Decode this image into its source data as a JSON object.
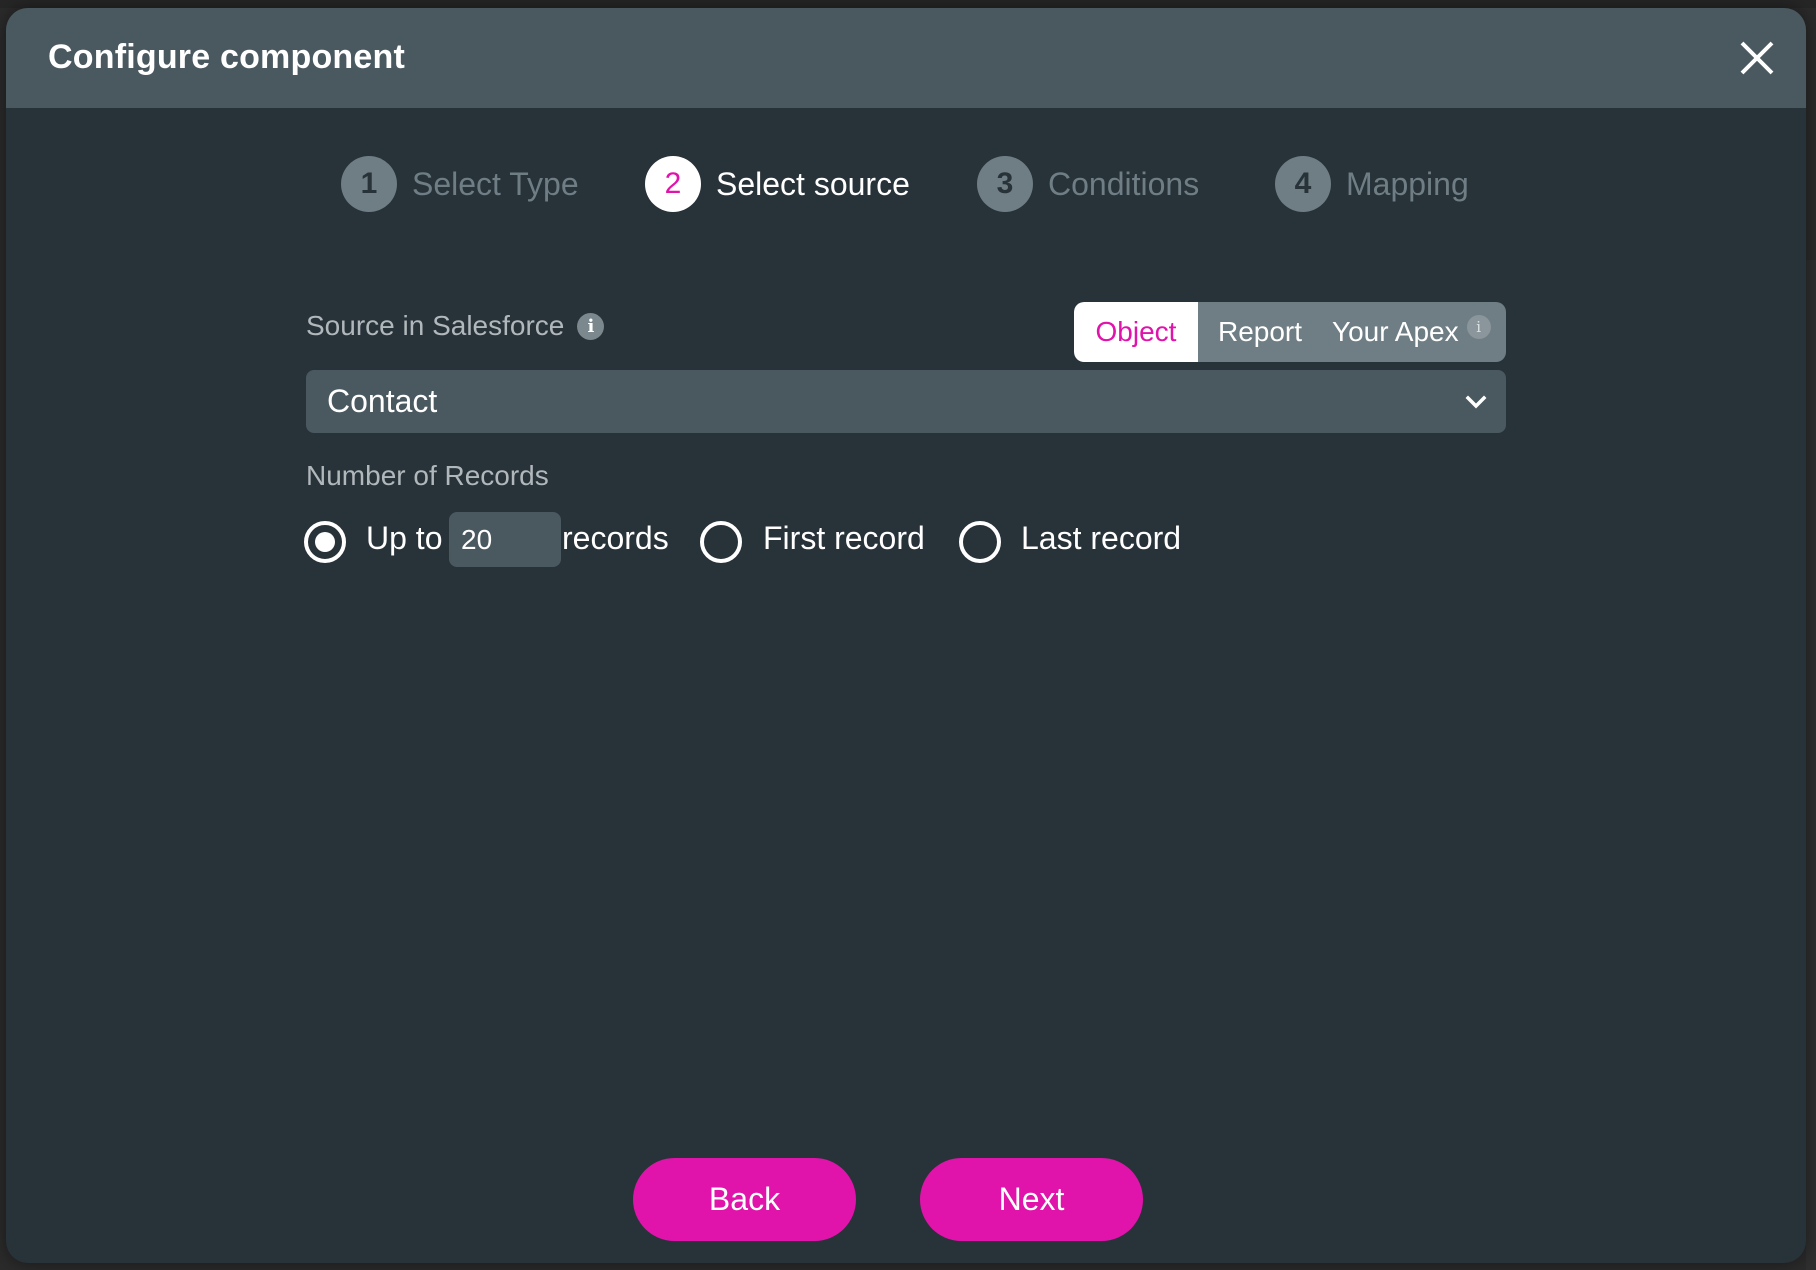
{
  "dialog": {
    "title": "Configure component",
    "close_icon": "close-icon"
  },
  "steps": [
    {
      "number": "1",
      "label": "Select Type",
      "state": "inactive"
    },
    {
      "number": "2",
      "label": "Select source",
      "state": "active"
    },
    {
      "number": "3",
      "label": "Conditions",
      "state": "inactive"
    },
    {
      "number": "4",
      "label": "Mapping",
      "state": "inactive"
    }
  ],
  "source": {
    "label": "Source in Salesforce",
    "info_icon": "i",
    "source_types": [
      {
        "label": "Object",
        "selected": true
      },
      {
        "label": "Report",
        "selected": false
      },
      {
        "label": "Your Apex",
        "selected": false,
        "info_icon": "i"
      }
    ],
    "selected_object": "Contact"
  },
  "records": {
    "label": "Number of Records",
    "options": [
      {
        "prefix": "Up to",
        "suffix": "records",
        "value": "20",
        "checked": true
      },
      {
        "label": "First record",
        "checked": false
      },
      {
        "label": "Last record",
        "checked": false
      }
    ]
  },
  "footer": {
    "back_label": "Back",
    "next_label": "Next"
  },
  "colors": {
    "accent": "#e014ab",
    "header_bg": "#4a5860",
    "body_bg": "#283239",
    "inactive_step": "#6f7e84"
  }
}
